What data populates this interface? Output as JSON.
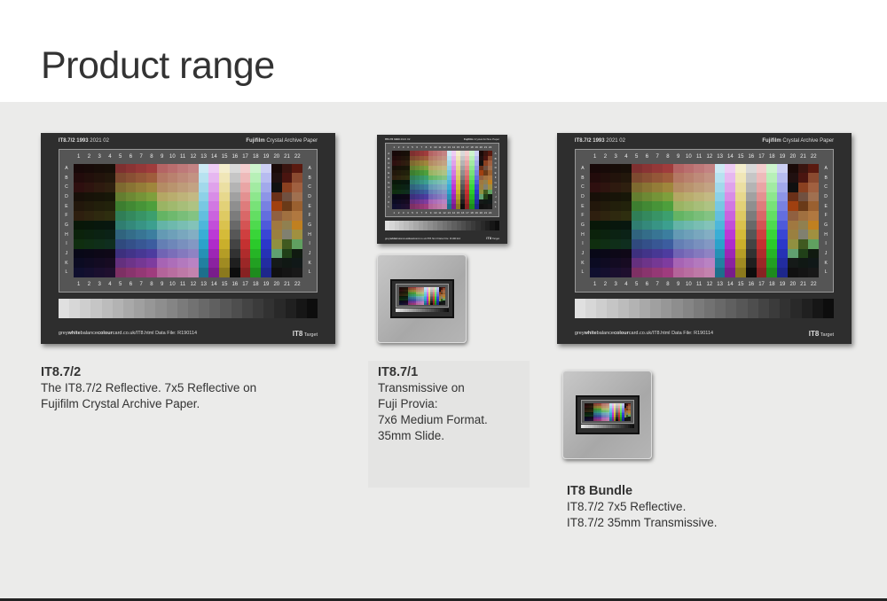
{
  "page_title": "Product range",
  "target_card": {
    "ref": "IT8.7/2 1993",
    "batch": "2021 02",
    "brand": "Fujifilm",
    "paper": "Crystal Archive Paper",
    "site_a": "grey",
    "site_b": "white",
    "site_c": "balance",
    "site_d": "colour",
    "site_e": "card.co.uk/IT8.html",
    "data_file": "Data File: R190114",
    "badge_a": "IT8",
    "badge_b": "Target",
    "columns": [
      "1",
      "2",
      "3",
      "4",
      "5",
      "6",
      "7",
      "8",
      "9",
      "10",
      "11",
      "12",
      "13",
      "14",
      "15",
      "16",
      "17",
      "18",
      "19",
      "20",
      "21",
      "22"
    ],
    "rows": [
      "A",
      "B",
      "C",
      "D",
      "E",
      "F",
      "G",
      "H",
      "I",
      "J",
      "K",
      "L"
    ]
  },
  "products": [
    {
      "name": "IT8.7/2",
      "lines": [
        "The IT8.7/2 Reflective. 7x5 Reflective on",
        "Fujifilm Crystal Archive Paper."
      ]
    },
    {
      "name": "IT8.7/1",
      "lines": [
        "Transmissive on",
        "Fuji Provia:",
        "7x6 Medium Format.",
        "35mm Slide."
      ]
    },
    {
      "name": "IT8 Bundle",
      "lines": [
        "IT8.7/2 7x5 Reflective.",
        "IT8.7/2 35mm Transmissive."
      ]
    }
  ]
}
